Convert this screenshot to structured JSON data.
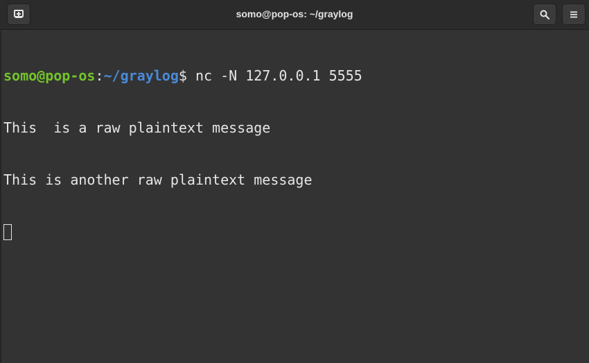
{
  "window": {
    "title": "somo@pop-os: ~/graylog"
  },
  "toolbar": {
    "new_tab_icon": "new-tab-icon",
    "search_icon": "search-icon",
    "menu_icon": "hamburger-menu-icon"
  },
  "terminal": {
    "prompt": {
      "user_host": "somo@pop-os",
      "colon": ":",
      "path": "~/graylog",
      "symbol": "$",
      "command": " nc -N 127.0.0.1 5555"
    },
    "output": [
      "This  is a raw plaintext message",
      "This is another raw plaintext message"
    ]
  },
  "colors": {
    "background": "#333333",
    "titlebar": "#2b2b2b",
    "prompt_user": "#73c42b",
    "prompt_path": "#4a8ad8",
    "text": "#e6e6e6"
  }
}
